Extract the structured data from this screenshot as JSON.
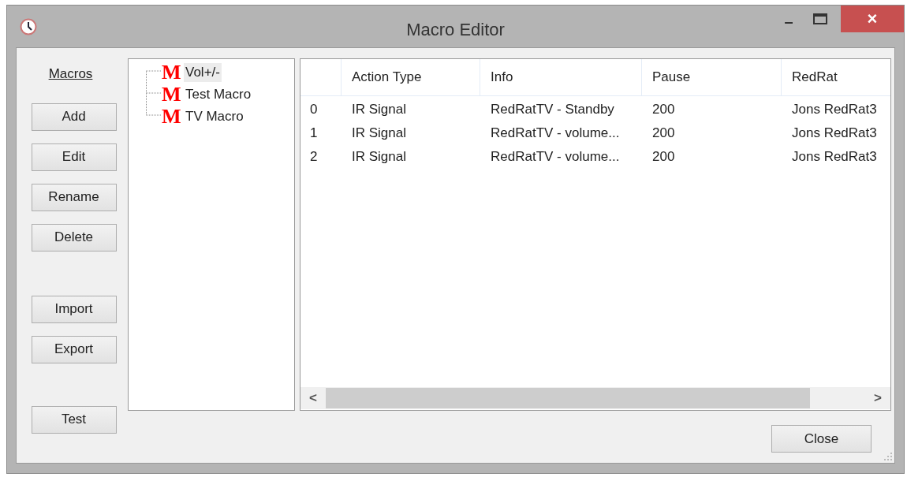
{
  "window": {
    "title": "Macro Editor",
    "controls": [
      "–",
      "×"
    ]
  },
  "macros_label": "Macros",
  "button_groups": [
    [
      "Add",
      "Edit",
      "Rename",
      "Delete"
    ],
    [
      "Import",
      "Export"
    ],
    [
      "Test"
    ]
  ],
  "tree": {
    "items": [
      {
        "label": "Vol+/-",
        "icon": "M",
        "selected": true
      },
      {
        "label": "Test Macro",
        "icon": "M",
        "selected": false
      },
      {
        "label": "TV Macro",
        "icon": "M",
        "selected": false
      }
    ]
  },
  "table": {
    "columns": [
      "",
      "Action Type",
      "Info",
      "Pause",
      "RedRat"
    ],
    "rows": [
      {
        "cells": [
          "0",
          "IR Signal",
          "RedRatTV - Standby",
          "200",
          "Jons RedRat3"
        ]
      },
      {
        "cells": [
          "1",
          "IR Signal",
          "RedRatTV - volume...",
          "200",
          "Jons RedRat3"
        ]
      },
      {
        "cells": [
          "2",
          "IR Signal",
          "RedRatTV - volume...",
          "200",
          "Jons RedRat3"
        ]
      }
    ],
    "scroll_left": "<",
    "scroll_right": ">"
  },
  "close_button": "Close"
}
